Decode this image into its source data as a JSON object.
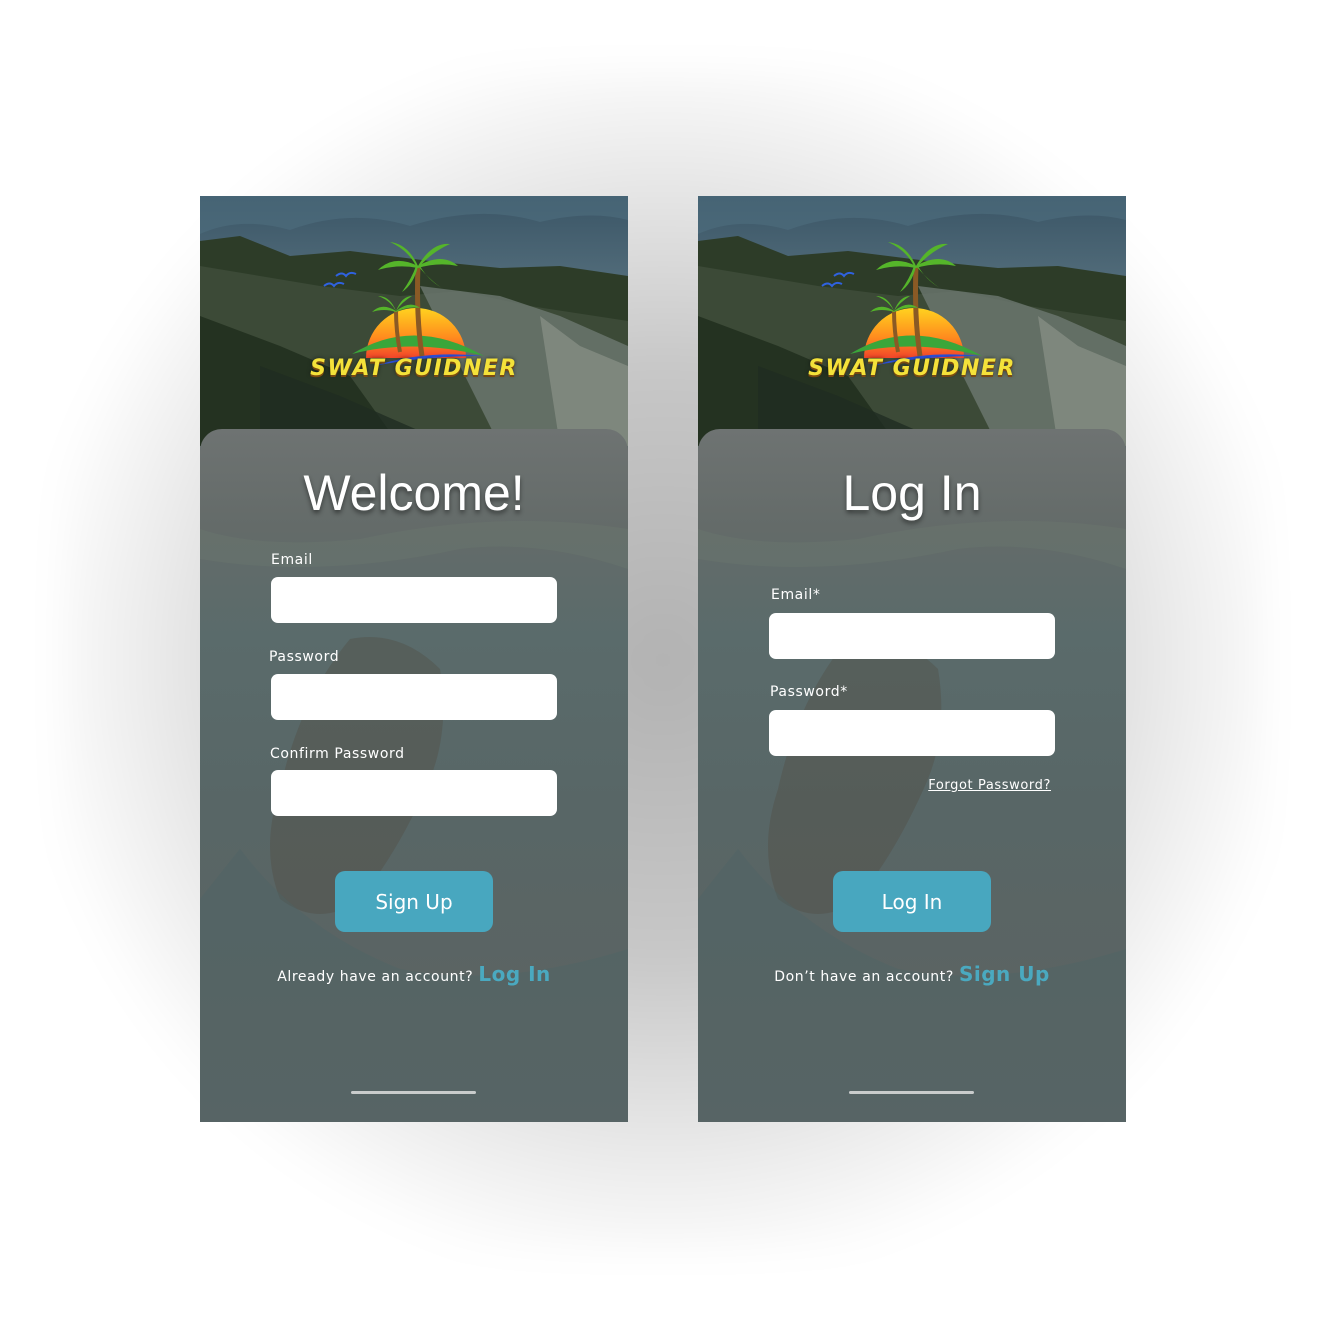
{
  "brand": {
    "name": "SWAT GUIDNER"
  },
  "signup_screen": {
    "title": "Welcome!",
    "email_label": "Email",
    "password_label": "Password",
    "confirm_password_label": "Confirm Password",
    "email_value": "",
    "password_value": "",
    "confirm_password_value": "",
    "submit_label": "Sign Up",
    "footer_text": "Already have an account?",
    "footer_link": "Log In"
  },
  "login_screen": {
    "title": "Log In",
    "email_label": "Email*",
    "password_label": "Password*",
    "email_value": "",
    "password_value": "",
    "forgot_label": "Forgot Password?",
    "submit_label": "Log In",
    "footer_text": "Don’t have an account?",
    "footer_link": "Sign Up"
  },
  "colors": {
    "accent": "#48a7bf",
    "link": "#4aa9c0",
    "brand_text": "#f4e23a",
    "page_background": "#ffffff"
  },
  "icons": [
    "palm-island-logo-icon",
    "birds-icon",
    "sun-icon"
  ]
}
